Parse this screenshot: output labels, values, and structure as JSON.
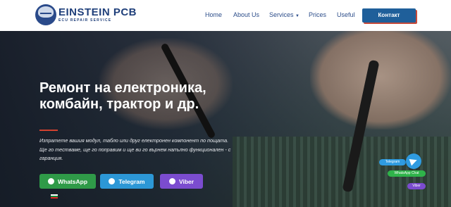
{
  "header": {
    "logo_main": "EINSTEIN PCB",
    "logo_sub": "ECU REPAIR SERVICE",
    "nav": [
      {
        "label": "Home"
      },
      {
        "label": "About Us"
      },
      {
        "label": "Services"
      },
      {
        "label": "Prices"
      },
      {
        "label": "Useful"
      }
    ],
    "cta_label": "Контакт"
  },
  "hero": {
    "headline": "Ремонт на електроника, комбайн, трактор и др.",
    "description": "Изпратете вашия модул, табло или друг електронен компонент по пощата. Ще го тестваме, ще го поправим и ще ви го върнем напълно функционален - с гаранция.",
    "buttons": [
      {
        "label": "WhatsApp"
      },
      {
        "label": "Telegram"
      },
      {
        "label": "Viber"
      }
    ]
  },
  "floating_contact": {
    "items": [
      {
        "label": "Telegram"
      },
      {
        "label": "WhatsApp Chat"
      },
      {
        "label": "Viber"
      }
    ]
  },
  "colors": {
    "brand": "#1f3f7a",
    "cta": "#1f5f9a",
    "accent_red": "#d2412f",
    "whatsapp": "#2f9a48",
    "telegram": "#2c97d6",
    "viber": "#7b4ccf"
  }
}
